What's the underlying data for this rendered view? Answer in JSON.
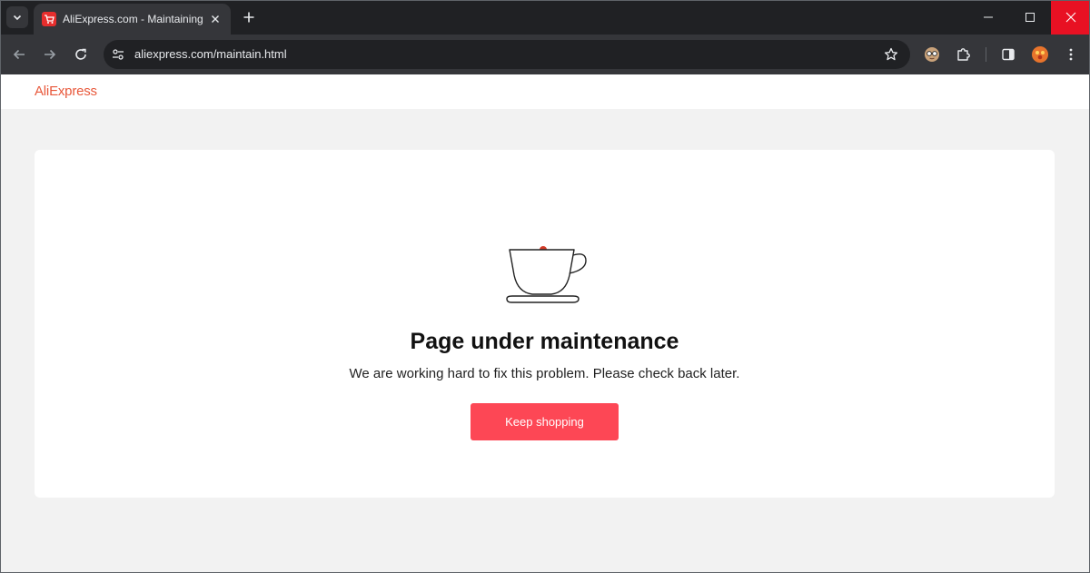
{
  "browser": {
    "tab": {
      "title": "AliExpress.com - Maintaining",
      "favicon": "aliexpress-cart-icon"
    },
    "omnibox": {
      "url": "aliexpress.com/maintain.html"
    },
    "icons": {
      "tab_search": "chevron-down-icon",
      "new_tab": "plus-icon",
      "back": "arrow-left-icon",
      "forward": "arrow-right-icon",
      "reload": "reload-icon",
      "site_info": "tune-icon",
      "bookmark": "star-icon",
      "extension_1": "glasses-face-icon",
      "extensions": "puzzle-icon",
      "side_panel": "side-panel-icon",
      "profile": "avatar-icon",
      "menu": "kebab-menu-icon",
      "minimize": "minimize-icon",
      "maximize": "maximize-icon",
      "close": "close-icon"
    }
  },
  "header": {
    "logo_text": "AliExpress"
  },
  "main": {
    "illustration": "coffee-cup-icon",
    "title": "Page under maintenance",
    "message": "We are working hard to fix this problem. Please check back later.",
    "button_label": "Keep shopping"
  },
  "colors": {
    "brand_red": "#e62e2d",
    "button_red": "#fd4755",
    "logo_orange": "#e8583b",
    "page_bg": "#f2f2f2",
    "card_bg": "#ffffff"
  }
}
